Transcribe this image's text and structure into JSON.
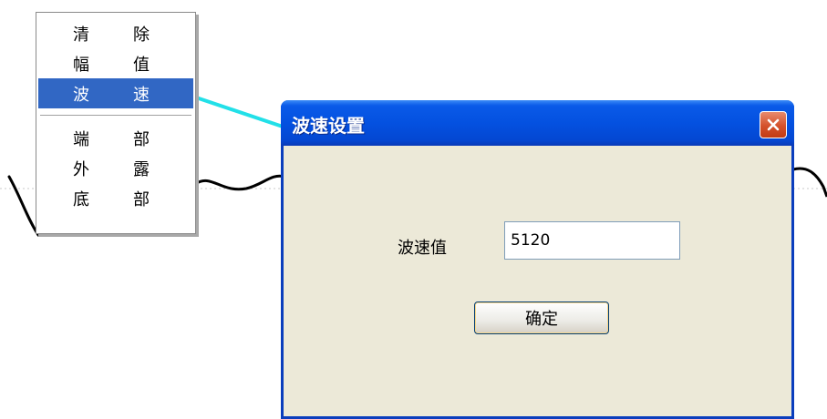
{
  "context_menu": {
    "items": [
      {
        "c1": "清",
        "c2": "除"
      },
      {
        "c1": "幅",
        "c2": "值"
      },
      {
        "c1": "波",
        "c2": "速"
      },
      {
        "c1": "端",
        "c2": "部"
      },
      {
        "c1": "外",
        "c2": "露"
      },
      {
        "c1": "底",
        "c2": "部"
      }
    ],
    "highlight_color": "#3167c4"
  },
  "dialog": {
    "title": "波速设置",
    "label": "波速值",
    "input_value": "5120",
    "ok_label": "确定",
    "titlebar_color": "#0451e0",
    "connector_color": "#22e0e8"
  }
}
